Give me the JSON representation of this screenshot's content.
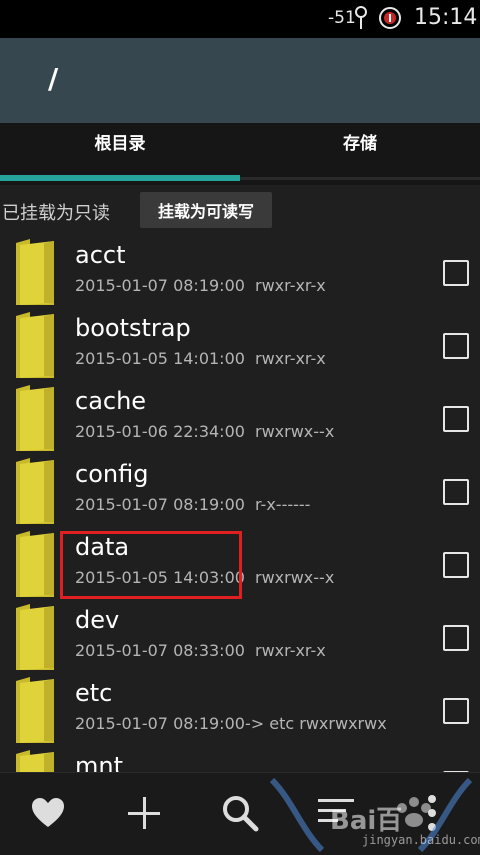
{
  "status_bar": {
    "signal_strength": "-51",
    "time": "15:14",
    "icons": [
      "wifi-icon",
      "alert-icon"
    ]
  },
  "path_bar": {
    "path": "/"
  },
  "tabs": [
    {
      "label": "根目录",
      "selected": true
    },
    {
      "label": "存储",
      "selected": false
    }
  ],
  "mount": {
    "status": "已挂载为只读",
    "button_label": "挂载为可读写"
  },
  "files": [
    {
      "name": "acct",
      "date": "2015-01-07 08:19:00",
      "perm": "rwxr-xr-x"
    },
    {
      "name": "bootstrap",
      "date": "2015-01-05 14:01:00",
      "perm": "rwxr-xr-x"
    },
    {
      "name": "cache",
      "date": "2015-01-06 22:34:00",
      "perm": "rwxrwx--x"
    },
    {
      "name": "config",
      "date": "2015-01-07 08:19:00",
      "perm": "r-x------"
    },
    {
      "name": "data",
      "date": "2015-01-05 14:03:00",
      "perm": "rwxrwx--x"
    },
    {
      "name": "dev",
      "date": "2015-01-07 08:33:00",
      "perm": "rwxr-xr-x"
    },
    {
      "name": "etc",
      "date": "2015-01-07 08:19:00",
      "perm": "-> etc  rwxrwxrwx"
    },
    {
      "name": "mnt",
      "date": "",
      "perm": ""
    }
  ],
  "toolbar": {
    "icons": [
      "heart-icon",
      "add-icon",
      "search-icon",
      "sort-icon",
      "more-icon"
    ]
  },
  "watermark": {
    "text": "Bai百",
    "sub": "jingyan.baidu.com"
  },
  "colors": {
    "accent": "#26a69a",
    "path_bar": "#37474f",
    "folder": "#e0d33a",
    "highlight": "#e02020"
  }
}
